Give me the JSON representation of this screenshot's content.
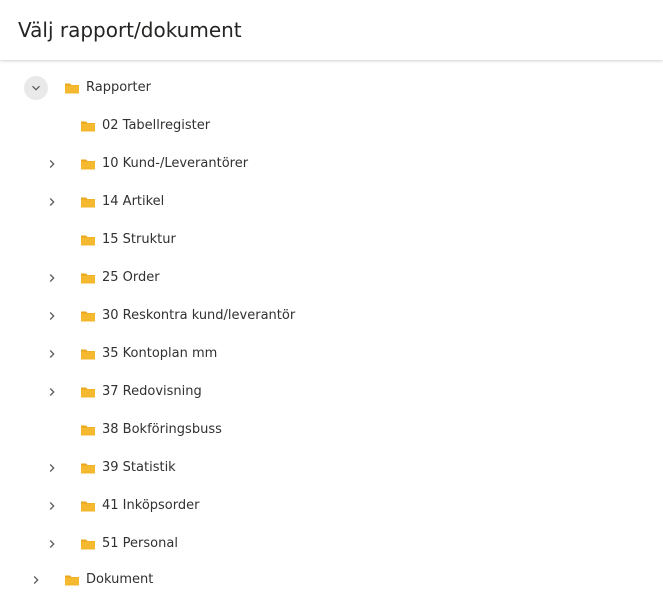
{
  "header": {
    "title": "Välj rapport/dokument"
  },
  "colors": {
    "folder": "#F5B92F",
    "folder_tab": "#E8A71E",
    "chevron": "#605E5C"
  },
  "tree": {
    "root": {
      "label": "Rapporter",
      "expanded": true,
      "icon": "folder-icon",
      "chevron_icon": "chevron-down-icon",
      "children": [
        {
          "label": "02 Tabellregister",
          "has_children": false
        },
        {
          "label": "10 Kund-/Leverantörer",
          "has_children": true
        },
        {
          "label": "14 Artikel",
          "has_children": true
        },
        {
          "label": "15 Struktur",
          "has_children": false
        },
        {
          "label": "25 Order",
          "has_children": true
        },
        {
          "label": "30 Reskontra kund/leverantör",
          "has_children": true
        },
        {
          "label": "35 Kontoplan mm",
          "has_children": true
        },
        {
          "label": "37 Redovisning",
          "has_children": true
        },
        {
          "label": "38 Bokföringsbuss",
          "has_children": false
        },
        {
          "label": "39 Statistik",
          "has_children": true
        },
        {
          "label": "41 Inköpsorder",
          "has_children": true
        },
        {
          "label": "51 Personal",
          "has_children": true
        }
      ]
    },
    "second_root": {
      "label": "Dokument",
      "expanded": false,
      "icon": "folder-icon",
      "chevron_icon": "chevron-right-icon"
    }
  }
}
